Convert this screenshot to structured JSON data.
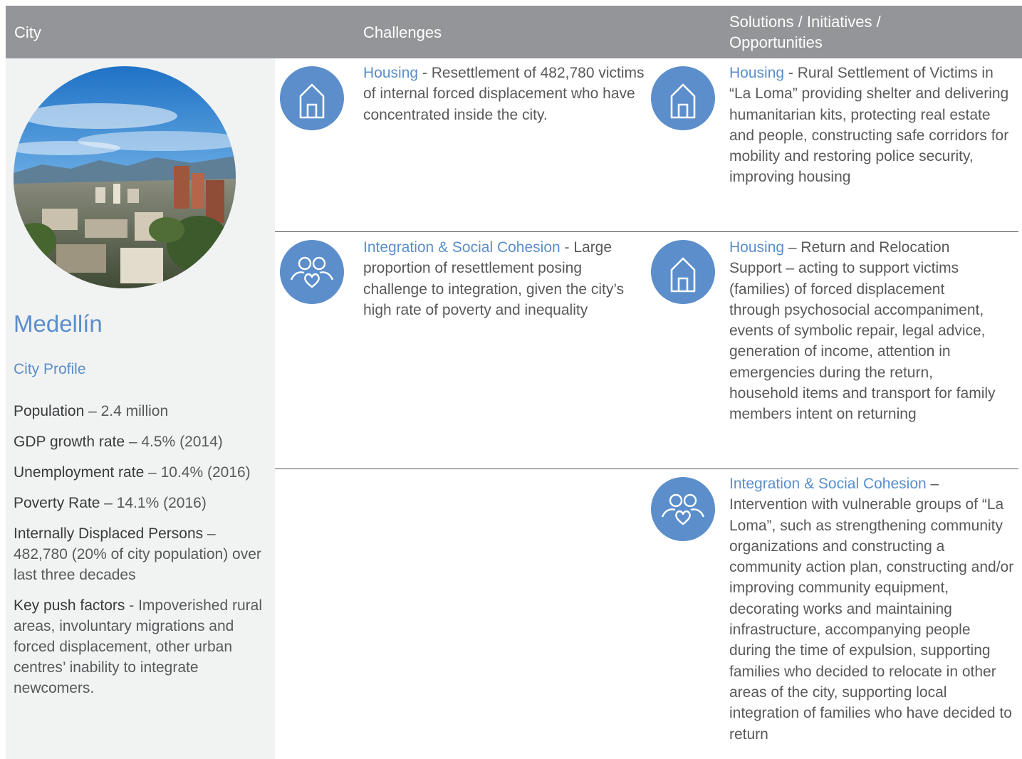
{
  "header": {
    "city": "City",
    "challenges": "Challenges",
    "solutions": "Solutions / Initiatives / Opportunities"
  },
  "city": {
    "name": "Medellín",
    "profile_title": "City Profile",
    "stats": [
      {
        "label": "Population",
        "value": " – 2.4 million"
      },
      {
        "label": "GDP growth rate",
        "value": " –  4.5% (2014)"
      },
      {
        "label": "Unemployment rate",
        "value": " – 10.4% (2016)"
      },
      {
        "label": "Poverty Rate",
        "value": " – 14.1% (2016)"
      },
      {
        "label": "Internally Displaced Persons",
        "value": " – 482,780 (20% of city population) over last three decades"
      },
      {
        "label": "Key push factors",
        "value": " - Impoverished rural areas, involuntary migrations and forced displacement, other urban centres’ inability to integrate newcomers."
      }
    ]
  },
  "icons": {
    "housing": "house-icon",
    "integration": "people-heart-icon",
    "accent_color": "#5b8ecb"
  },
  "challenges": [
    {
      "topic": "Housing",
      "text": " - Resettlement of 482,780 victims of internal forced displacement who have concentrated inside the city."
    },
    {
      "topic": "Integration & Social Cohesion",
      "text": " - Large proportion of resettlement posing challenge to integration, given the city’s high rate of poverty and inequality"
    }
  ],
  "solutions": [
    {
      "topic": "Housing",
      "text": " - Rural Settlement of Victims in “La Loma” providing shelter and delivering humanitarian kits, protecting real estate and people, constructing safe corridors for mobility and restoring police security, improving housing"
    },
    {
      "topic": "Housing",
      "text": " – Return and Relocation Support – acting to support victims (families) of forced displacement through psychosocial accompaniment, events of symbolic repair, legal advice, generation of income, attention in emergencies during the return, household items and transport for family members intent on returning"
    },
    {
      "topic": "Integration & Social Cohesion",
      "text": " – Intervention with vulnerable groups of “La Loma”, such as strengthening community organizations and constructing a community action plan, constructing and/or improving community equipment, decorating works and maintaining infrastructure, accompanying people during the time of expulsion, supporting families who decided to relocate in other areas of the city, supporting local integration of families who have decided to return"
    }
  ]
}
